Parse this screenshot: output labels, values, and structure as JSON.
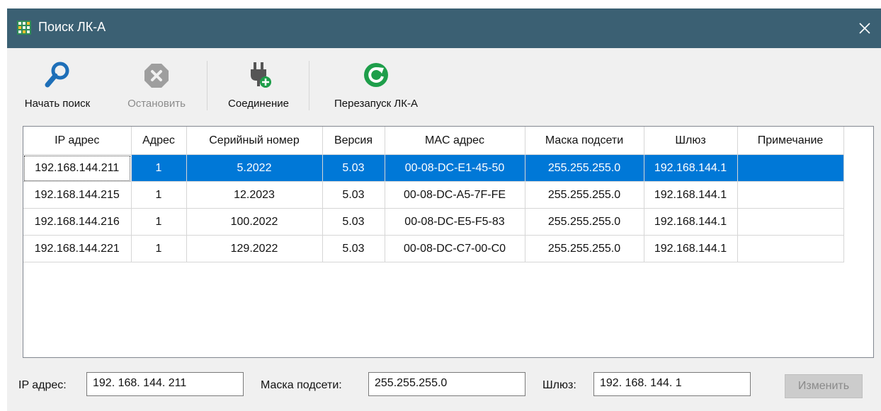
{
  "window": {
    "title": "Поиск ЛК-А"
  },
  "toolbar": {
    "start_search": "Начать поиск",
    "stop": "Остановить",
    "connect": "Соединение",
    "restart": "Перезапуск ЛК-А"
  },
  "table": {
    "headers": [
      "IP адрес",
      "Адрес",
      "Серийный номер",
      "Версия",
      "MAC адрес",
      "Маска подсети",
      "Шлюз",
      "Примечание"
    ],
    "rows": [
      [
        "192.168.144.211",
        "1",
        "5.2022",
        "5.03",
        "00-08-DC-E1-45-50",
        "255.255.255.0",
        "192.168.144.1",
        ""
      ],
      [
        "192.168.144.215",
        "1",
        "12.2023",
        "5.03",
        "00-08-DC-A5-7F-FE",
        "255.255.255.0",
        "192.168.144.1",
        ""
      ],
      [
        "192.168.144.216",
        "1",
        "100.2022",
        "5.03",
        "00-08-DC-E5-F5-83",
        "255.255.255.0",
        "192.168.144.1",
        ""
      ],
      [
        "192.168.144.221",
        "1",
        "129.2022",
        "5.03",
        "00-08-DC-C7-00-C0",
        "255.255.255.0",
        "192.168.144.1",
        ""
      ]
    ],
    "selected_row": 0
  },
  "form": {
    "ip_label": "IP адрес:",
    "ip_value": "192. 168. 144. 211",
    "mask_label": "Маска подсети:",
    "mask_value": "255.255.255.0",
    "gateway_label": "Шлюз:",
    "gateway_value": "192. 168. 144. 1",
    "change_button": "Изменить"
  },
  "colors": {
    "titlebar": "#3b6073",
    "selection": "#0078d7",
    "search_icon": "#1e6fb8",
    "restart_icon": "#1e9e4a"
  },
  "icons": [
    "app-grid-icon",
    "close-icon",
    "search-icon",
    "stop-icon",
    "plug-add-icon",
    "restart-icon"
  ]
}
